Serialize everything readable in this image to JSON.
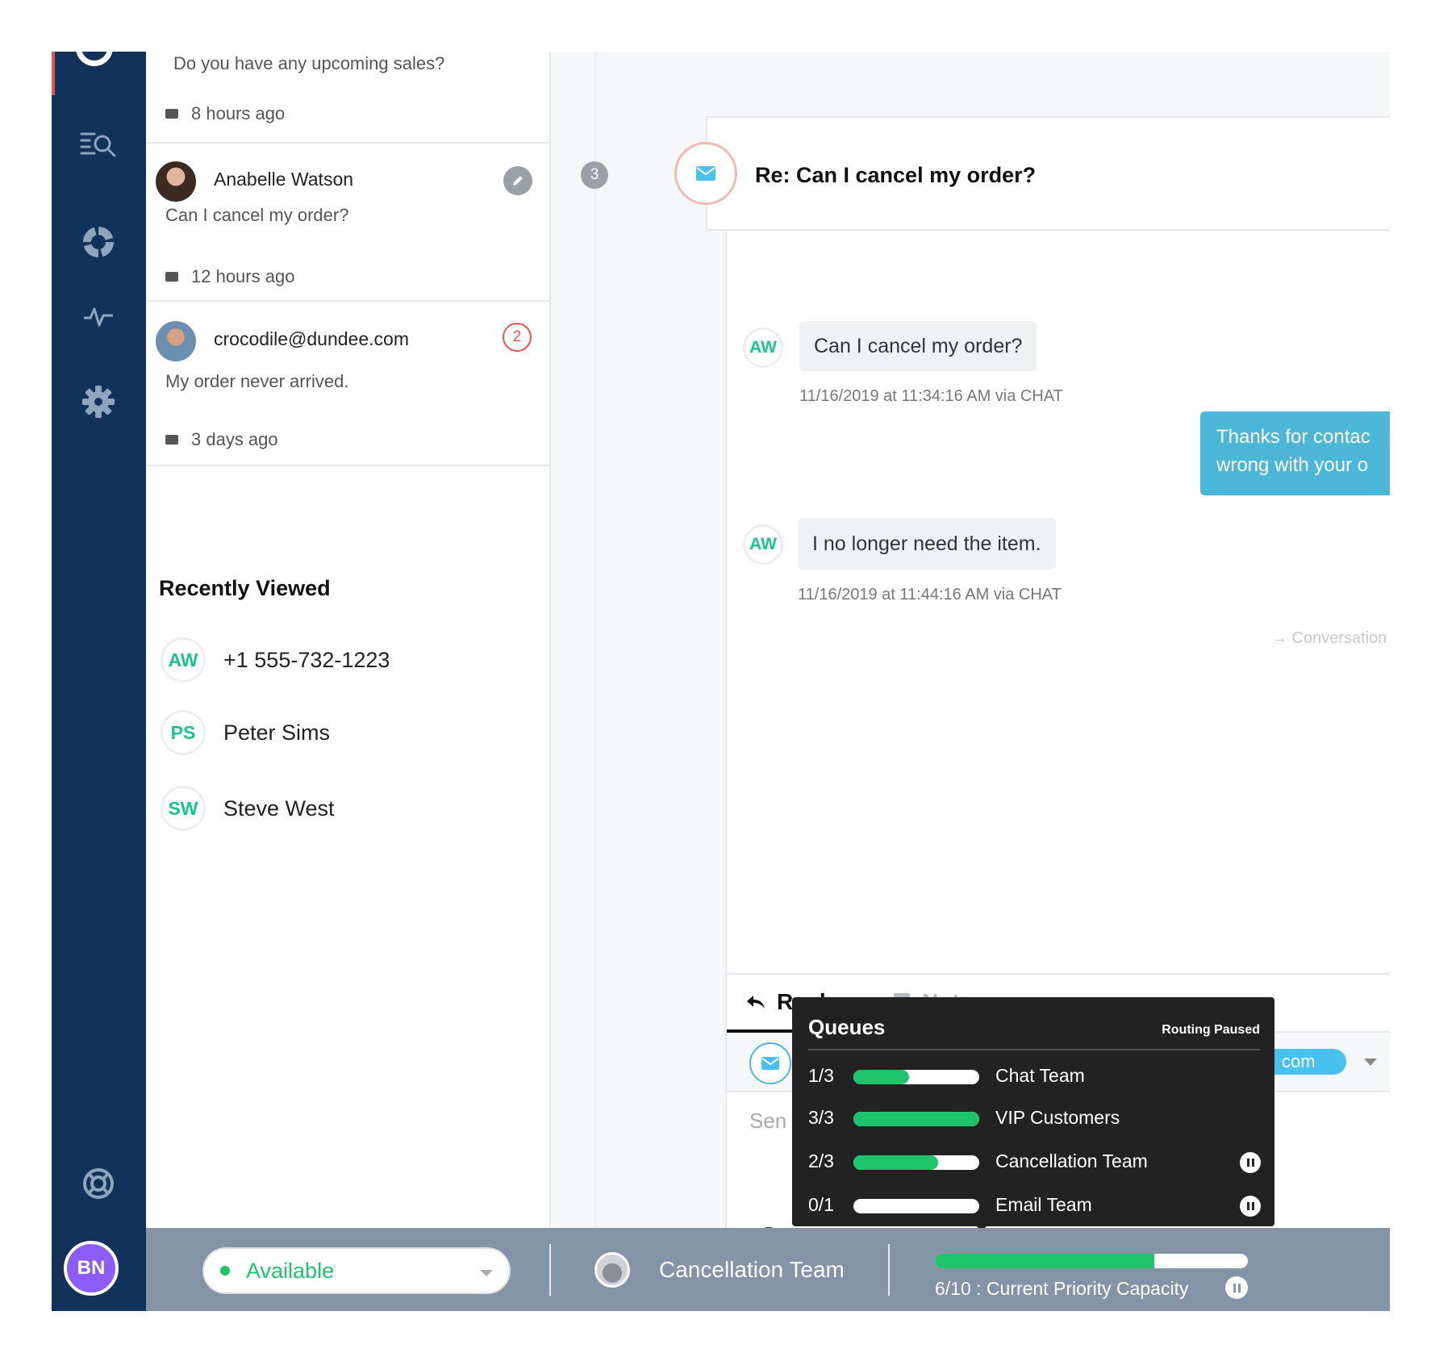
{
  "sidebar": {
    "avatar_initials": "BN",
    "icons": [
      "search-list-icon",
      "reports-donut-icon",
      "activity-icon",
      "settings-gear-icon",
      "help-lifebuoy-icon"
    ]
  },
  "conversations": [
    {
      "name": "",
      "preview": "Do you have any upcoming sales?",
      "time": "8 hours ago"
    },
    {
      "name": "Anabelle Watson",
      "preview": "Can I cancel my order?",
      "time": "12 hours ago"
    },
    {
      "name": "crocodile@dundee.com",
      "preview": "My order never arrived.",
      "time": "3 days ago",
      "badge": "2"
    }
  ],
  "recently_viewed": {
    "title": "Recently Viewed",
    "items": [
      {
        "initials": "AW",
        "label": "+1 555-732-1223"
      },
      {
        "initials": "PS",
        "label": "Peter Sims"
      },
      {
        "initials": "SW",
        "label": "Steve West"
      }
    ]
  },
  "conversation": {
    "step": "3",
    "title": "Re: Can I cancel my order?",
    "messages": [
      {
        "initials": "AW",
        "text": "Can I cancel my order?",
        "meta": "11/16/2019 at 11:34:16 AM via CHAT"
      },
      {
        "initials": "AW",
        "text": "I no longer need the item.",
        "meta": "11/16/2019 at 11:44:16 AM via CHAT"
      }
    ],
    "agent_message": {
      "line1": "Thanks for contac",
      "line2": "wrong with your o"
    },
    "link": "→ Conversation"
  },
  "composer": {
    "reply_tab": "Reply",
    "note_tab": "Note",
    "to_pill": "com",
    "placeholder": "Sen"
  },
  "queues": {
    "title": "Queues",
    "status": "Routing Paused",
    "rows": [
      {
        "count": "1/3",
        "name": "Chat Team",
        "fill": 0.44,
        "paused": false
      },
      {
        "count": "3/3",
        "name": "VIP Customers",
        "fill": 1.0,
        "paused": false
      },
      {
        "count": "2/3",
        "name": "Cancellation Team",
        "fill": 0.67,
        "paused": true
      },
      {
        "count": "0/1",
        "name": "Email Team",
        "fill": 0.0,
        "paused": true
      }
    ]
  },
  "statusbar": {
    "availability": "Available",
    "team": "Cancellation Team",
    "capacity_label": "6/10 : Current Priority Capacity",
    "capacity_fill": 0.7
  },
  "colors": {
    "rail": "#12325a",
    "accent_green": "#1ec46b",
    "accent_red": "#e8554f",
    "agent_bubble": "#4bb6d6",
    "statusbar": "#8593a6"
  }
}
